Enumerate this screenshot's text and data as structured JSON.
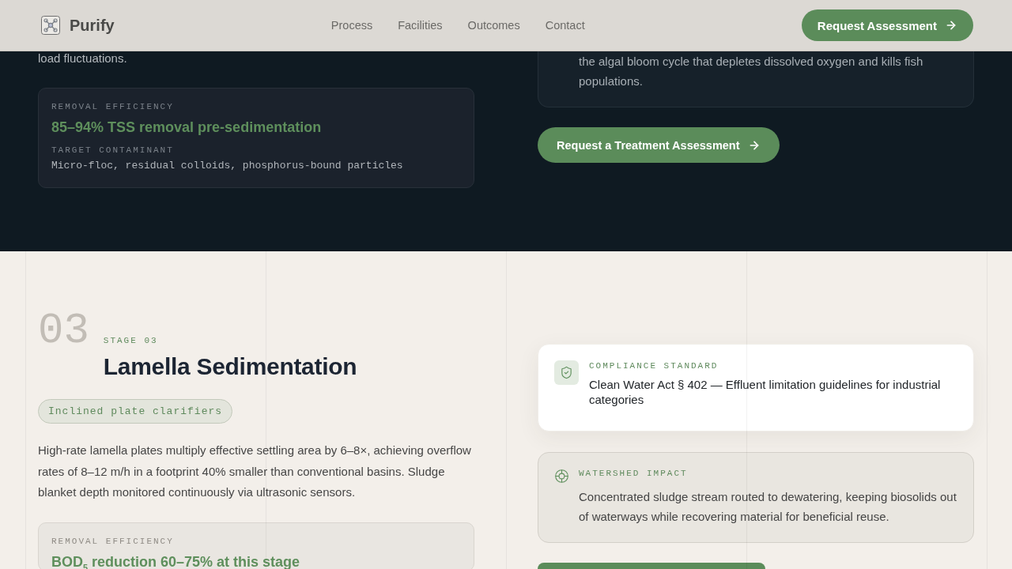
{
  "header": {
    "brand": "Purify",
    "nav": [
      {
        "label": "Process"
      },
      {
        "label": "Facilities"
      },
      {
        "label": "Outcomes"
      },
      {
        "label": "Contact"
      }
    ],
    "cta": "Request Assessment"
  },
  "previous_stage": {
    "description": "load fluctuations.",
    "metrics": [
      {
        "kind": "highlight",
        "label": "REMOVAL EFFICIENCY",
        "value": "85–94% TSS removal pre-sedimentation"
      },
      {
        "kind": "mono",
        "label": "TARGET CONTAMINANT",
        "value": "Micro-floc, residual colloids, phosphorus-bound particles"
      }
    ],
    "impact_text": "the algal bloom cycle that depletes dissolved oxygen and kills fish populations.",
    "cta": "Request a Treatment Assessment"
  },
  "stage": {
    "number": "03",
    "eyebrow": "STAGE 03",
    "title": "Lamella Sedimentation",
    "tag": "Inclined plate clarifiers",
    "description": "High-rate lamella plates multiply effective settling area by 6–8×, achieving overflow rates of 8–12 m/h in a footprint 40% smaller than conventional basins. Sludge blanket depth monitored continuously via ultrasonic sensors.",
    "metrics": [
      {
        "kind": "highlight",
        "label": "REMOVAL EFFICIENCY",
        "value": "BOD$_{5}$ reduction 60–75% at this stage"
      }
    ],
    "compliance": {
      "label": "COMPLIANCE STANDARD",
      "text": "Clean Water Act § 402 — Effluent limitation guidelines for industrial categories"
    },
    "impact": {
      "label": "WATERSHED IMPACT",
      "text": "Concentrated sludge stream routed to dewatering, keeping biosolids out of waterways while recovering material for beneficial reuse."
    }
  }
}
